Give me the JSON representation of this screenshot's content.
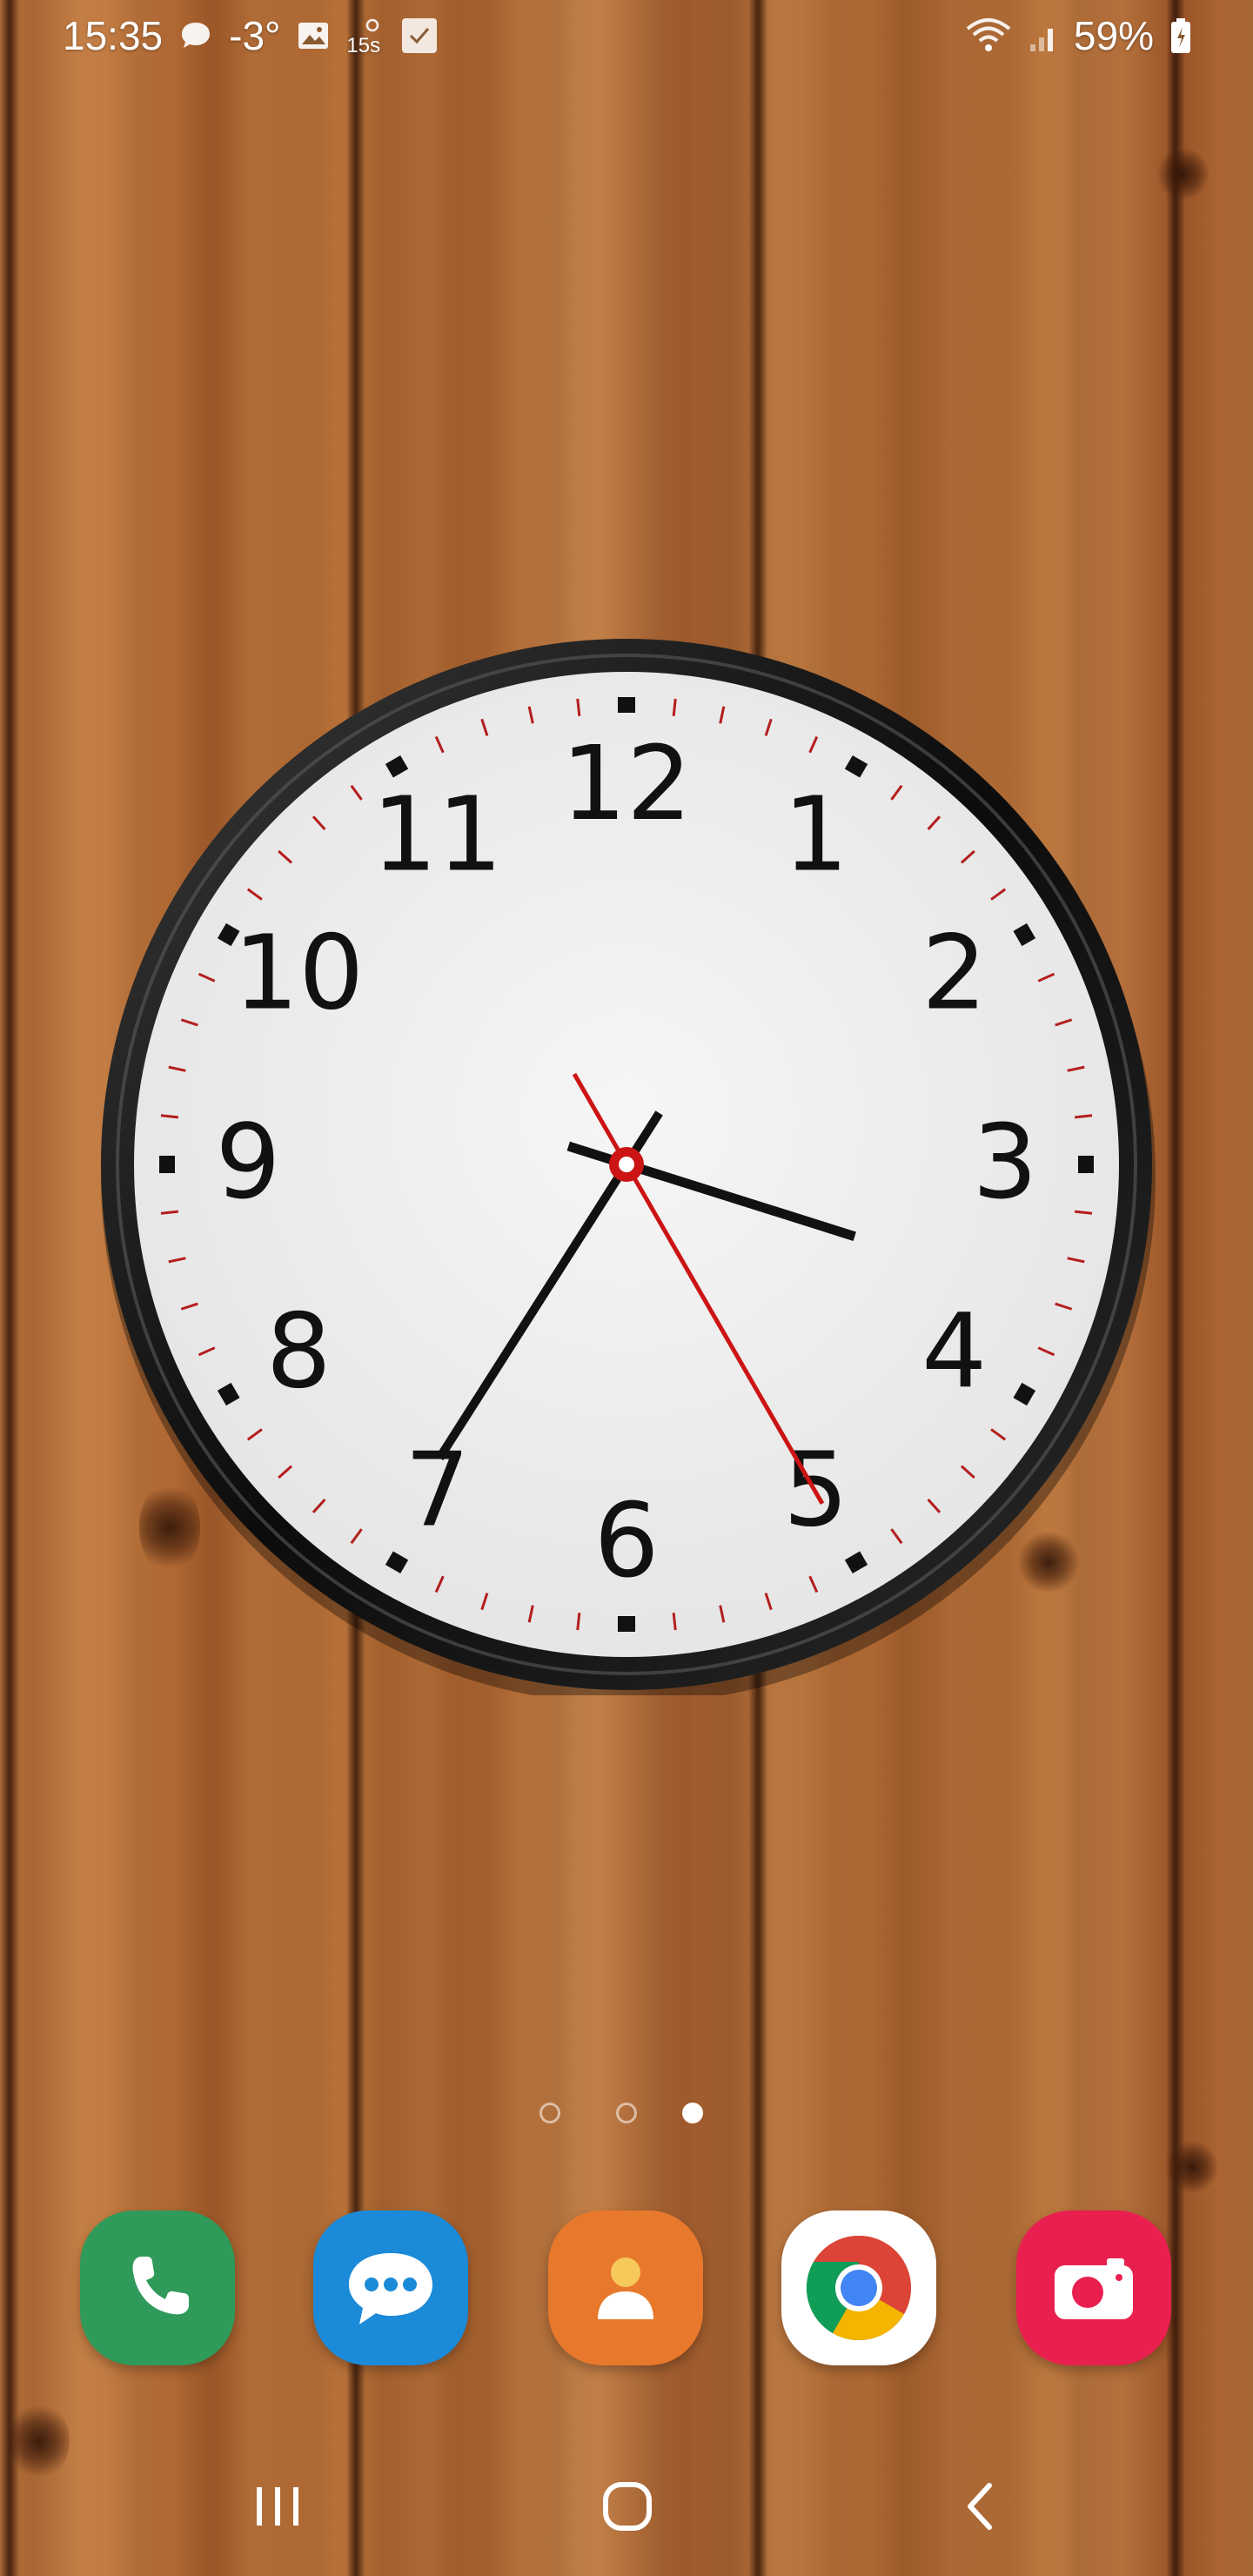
{
  "status_bar": {
    "time": "15:35",
    "temperature": "-3°",
    "notif_small_text": "15s",
    "battery_percent": "59%",
    "icons": [
      "chat-bubble-icon",
      "image-icon",
      "stopwatch-icon",
      "checkbox-icon",
      "wifi-icon",
      "signal-icon",
      "battery-icon"
    ]
  },
  "clock": {
    "numerals": [
      "12",
      "1",
      "2",
      "3",
      "4",
      "5",
      "6",
      "7",
      "8",
      "9",
      "10",
      "11"
    ],
    "time": {
      "hours": 15,
      "minutes": 35,
      "seconds": 25
    },
    "colors": {
      "rim": "#111111",
      "face": "#f1f1f1",
      "hands": "#111111",
      "second_hand": "#cc1414",
      "minor_ticks": "#b41e1e"
    }
  },
  "page_indicator": {
    "count": 3,
    "active_index": 2
  },
  "dock": {
    "apps": [
      {
        "name": "phone",
        "icon": "phone-icon",
        "color": "#2f9a5a"
      },
      {
        "name": "messages",
        "icon": "message-bubble-icon",
        "color": "#1b8ad8"
      },
      {
        "name": "contacts",
        "icon": "contact-person-icon",
        "color": "#e8782c"
      },
      {
        "name": "chrome",
        "icon": "chrome-icon",
        "color": "#ffffff"
      },
      {
        "name": "camera",
        "icon": "camera-icon",
        "color": "#e9204f"
      }
    ]
  },
  "nav_bar": {
    "buttons": [
      "recent-apps-icon",
      "home-icon",
      "back-icon"
    ]
  }
}
